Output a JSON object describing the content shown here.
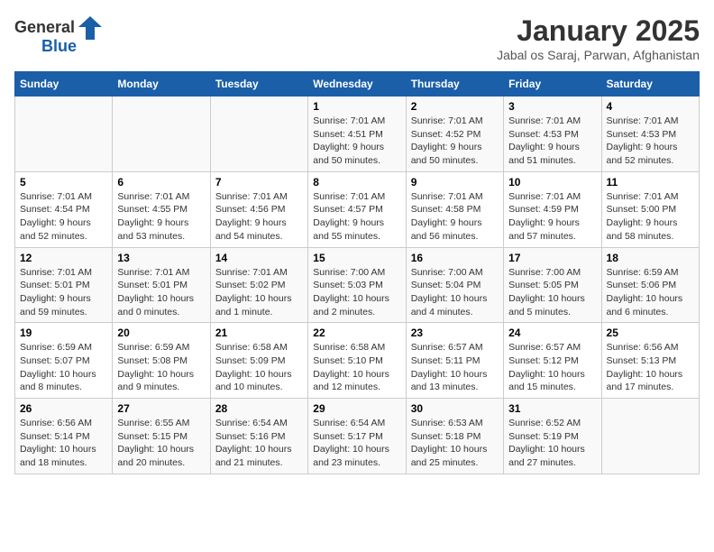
{
  "header": {
    "logo_general": "General",
    "logo_blue": "Blue",
    "calendar_title": "January 2025",
    "calendar_subtitle": "Jabal os Saraj, Parwan, Afghanistan"
  },
  "weekdays": [
    "Sunday",
    "Monday",
    "Tuesday",
    "Wednesday",
    "Thursday",
    "Friday",
    "Saturday"
  ],
  "weeks": [
    [
      {
        "day": "",
        "sunrise": "",
        "sunset": "",
        "daylight": ""
      },
      {
        "day": "",
        "sunrise": "",
        "sunset": "",
        "daylight": ""
      },
      {
        "day": "",
        "sunrise": "",
        "sunset": "",
        "daylight": ""
      },
      {
        "day": "1",
        "sunrise": "Sunrise: 7:01 AM",
        "sunset": "Sunset: 4:51 PM",
        "daylight": "Daylight: 9 hours and 50 minutes."
      },
      {
        "day": "2",
        "sunrise": "Sunrise: 7:01 AM",
        "sunset": "Sunset: 4:52 PM",
        "daylight": "Daylight: 9 hours and 50 minutes."
      },
      {
        "day": "3",
        "sunrise": "Sunrise: 7:01 AM",
        "sunset": "Sunset: 4:53 PM",
        "daylight": "Daylight: 9 hours and 51 minutes."
      },
      {
        "day": "4",
        "sunrise": "Sunrise: 7:01 AM",
        "sunset": "Sunset: 4:53 PM",
        "daylight": "Daylight: 9 hours and 52 minutes."
      }
    ],
    [
      {
        "day": "5",
        "sunrise": "Sunrise: 7:01 AM",
        "sunset": "Sunset: 4:54 PM",
        "daylight": "Daylight: 9 hours and 52 minutes."
      },
      {
        "day": "6",
        "sunrise": "Sunrise: 7:01 AM",
        "sunset": "Sunset: 4:55 PM",
        "daylight": "Daylight: 9 hours and 53 minutes."
      },
      {
        "day": "7",
        "sunrise": "Sunrise: 7:01 AM",
        "sunset": "Sunset: 4:56 PM",
        "daylight": "Daylight: 9 hours and 54 minutes."
      },
      {
        "day": "8",
        "sunrise": "Sunrise: 7:01 AM",
        "sunset": "Sunset: 4:57 PM",
        "daylight": "Daylight: 9 hours and 55 minutes."
      },
      {
        "day": "9",
        "sunrise": "Sunrise: 7:01 AM",
        "sunset": "Sunset: 4:58 PM",
        "daylight": "Daylight: 9 hours and 56 minutes."
      },
      {
        "day": "10",
        "sunrise": "Sunrise: 7:01 AM",
        "sunset": "Sunset: 4:59 PM",
        "daylight": "Daylight: 9 hours and 57 minutes."
      },
      {
        "day": "11",
        "sunrise": "Sunrise: 7:01 AM",
        "sunset": "Sunset: 5:00 PM",
        "daylight": "Daylight: 9 hours and 58 minutes."
      }
    ],
    [
      {
        "day": "12",
        "sunrise": "Sunrise: 7:01 AM",
        "sunset": "Sunset: 5:01 PM",
        "daylight": "Daylight: 9 hours and 59 minutes."
      },
      {
        "day": "13",
        "sunrise": "Sunrise: 7:01 AM",
        "sunset": "Sunset: 5:01 PM",
        "daylight": "Daylight: 10 hours and 0 minutes."
      },
      {
        "day": "14",
        "sunrise": "Sunrise: 7:01 AM",
        "sunset": "Sunset: 5:02 PM",
        "daylight": "Daylight: 10 hours and 1 minute."
      },
      {
        "day": "15",
        "sunrise": "Sunrise: 7:00 AM",
        "sunset": "Sunset: 5:03 PM",
        "daylight": "Daylight: 10 hours and 2 minutes."
      },
      {
        "day": "16",
        "sunrise": "Sunrise: 7:00 AM",
        "sunset": "Sunset: 5:04 PM",
        "daylight": "Daylight: 10 hours and 4 minutes."
      },
      {
        "day": "17",
        "sunrise": "Sunrise: 7:00 AM",
        "sunset": "Sunset: 5:05 PM",
        "daylight": "Daylight: 10 hours and 5 minutes."
      },
      {
        "day": "18",
        "sunrise": "Sunrise: 6:59 AM",
        "sunset": "Sunset: 5:06 PM",
        "daylight": "Daylight: 10 hours and 6 minutes."
      }
    ],
    [
      {
        "day": "19",
        "sunrise": "Sunrise: 6:59 AM",
        "sunset": "Sunset: 5:07 PM",
        "daylight": "Daylight: 10 hours and 8 minutes."
      },
      {
        "day": "20",
        "sunrise": "Sunrise: 6:59 AM",
        "sunset": "Sunset: 5:08 PM",
        "daylight": "Daylight: 10 hours and 9 minutes."
      },
      {
        "day": "21",
        "sunrise": "Sunrise: 6:58 AM",
        "sunset": "Sunset: 5:09 PM",
        "daylight": "Daylight: 10 hours and 10 minutes."
      },
      {
        "day": "22",
        "sunrise": "Sunrise: 6:58 AM",
        "sunset": "Sunset: 5:10 PM",
        "daylight": "Daylight: 10 hours and 12 minutes."
      },
      {
        "day": "23",
        "sunrise": "Sunrise: 6:57 AM",
        "sunset": "Sunset: 5:11 PM",
        "daylight": "Daylight: 10 hours and 13 minutes."
      },
      {
        "day": "24",
        "sunrise": "Sunrise: 6:57 AM",
        "sunset": "Sunset: 5:12 PM",
        "daylight": "Daylight: 10 hours and 15 minutes."
      },
      {
        "day": "25",
        "sunrise": "Sunrise: 6:56 AM",
        "sunset": "Sunset: 5:13 PM",
        "daylight": "Daylight: 10 hours and 17 minutes."
      }
    ],
    [
      {
        "day": "26",
        "sunrise": "Sunrise: 6:56 AM",
        "sunset": "Sunset: 5:14 PM",
        "daylight": "Daylight: 10 hours and 18 minutes."
      },
      {
        "day": "27",
        "sunrise": "Sunrise: 6:55 AM",
        "sunset": "Sunset: 5:15 PM",
        "daylight": "Daylight: 10 hours and 20 minutes."
      },
      {
        "day": "28",
        "sunrise": "Sunrise: 6:54 AM",
        "sunset": "Sunset: 5:16 PM",
        "daylight": "Daylight: 10 hours and 21 minutes."
      },
      {
        "day": "29",
        "sunrise": "Sunrise: 6:54 AM",
        "sunset": "Sunset: 5:17 PM",
        "daylight": "Daylight: 10 hours and 23 minutes."
      },
      {
        "day": "30",
        "sunrise": "Sunrise: 6:53 AM",
        "sunset": "Sunset: 5:18 PM",
        "daylight": "Daylight: 10 hours and 25 minutes."
      },
      {
        "day": "31",
        "sunrise": "Sunrise: 6:52 AM",
        "sunset": "Sunset: 5:19 PM",
        "daylight": "Daylight: 10 hours and 27 minutes."
      },
      {
        "day": "",
        "sunrise": "",
        "sunset": "",
        "daylight": ""
      }
    ]
  ]
}
